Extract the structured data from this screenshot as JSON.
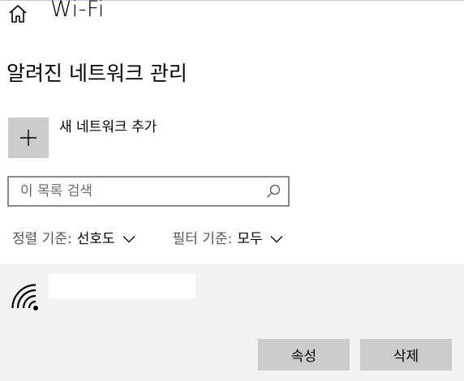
{
  "header": {
    "home_icon": "home-icon",
    "title": "Wi-Fi"
  },
  "section": {
    "title": "알려진 네트워크 관리"
  },
  "add_network": {
    "icon": "plus-icon",
    "label": "새 네트워크 추가"
  },
  "search": {
    "placeholder": "이 목록 검색",
    "value": "",
    "icon": "search-icon"
  },
  "filters": {
    "sort": {
      "label": "정렬 기준:",
      "value": "선호도"
    },
    "filter": {
      "label": "필터 기준:",
      "value": "모두"
    }
  },
  "network": {
    "icon": "wifi-signal-icon",
    "name": ""
  },
  "actions": {
    "properties_label": "속성",
    "delete_label": "삭제"
  },
  "colors": {
    "tile_gray": "#cccccc",
    "panel_bg": "#f2f2f2",
    "border_gray": "#8a8a8a"
  }
}
